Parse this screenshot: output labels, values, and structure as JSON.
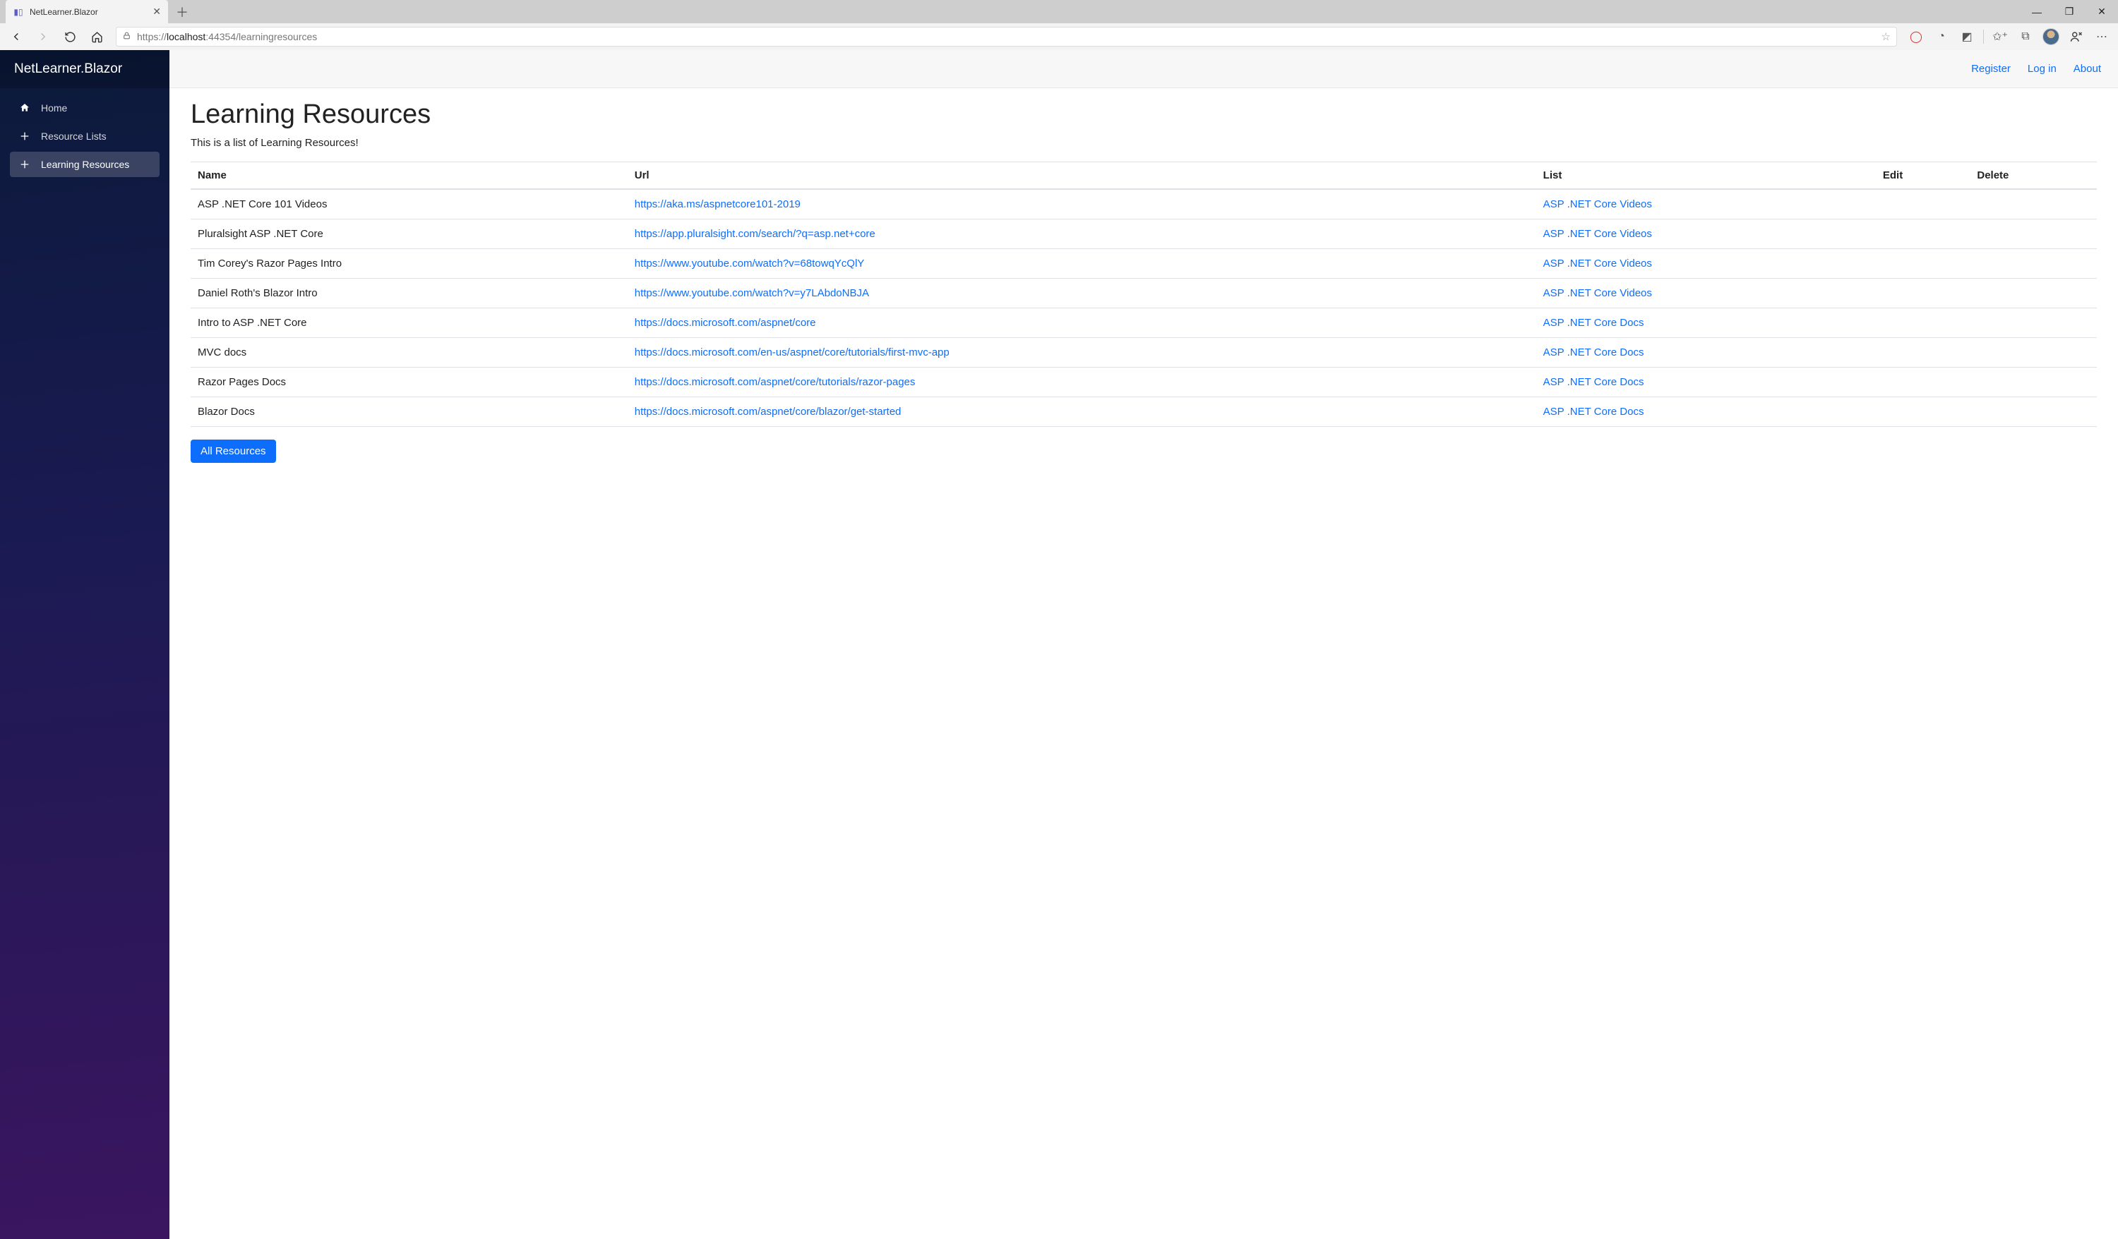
{
  "browser": {
    "tab_title": "NetLearner.Blazor",
    "url_scheme": "https://",
    "url_host": "localhost",
    "url_port_path": ":44354/learningresources"
  },
  "sidebar": {
    "brand": "NetLearner.Blazor",
    "items": [
      {
        "icon": "home",
        "label": "Home",
        "active": false
      },
      {
        "icon": "plus",
        "label": "Resource Lists",
        "active": false
      },
      {
        "icon": "plus",
        "label": "Learning Resources",
        "active": true
      }
    ]
  },
  "topbar": {
    "register": "Register",
    "login": "Log in",
    "about": "About"
  },
  "page": {
    "title": "Learning Resources",
    "subtitle": "This is a list of Learning Resources!",
    "columns": {
      "name": "Name",
      "url": "Url",
      "list": "List",
      "edit": "Edit",
      "delete": "Delete"
    },
    "rows": [
      {
        "name": "ASP .NET Core 101 Videos",
        "url": "https://aka.ms/aspnetcore101-2019",
        "list": "ASP .NET Core Videos"
      },
      {
        "name": "Pluralsight ASP .NET Core",
        "url": "https://app.pluralsight.com/search/?q=asp.net+core",
        "list": "ASP .NET Core Videos"
      },
      {
        "name": "Tim Corey's Razor Pages Intro",
        "url": "https://www.youtube.com/watch?v=68towqYcQlY",
        "list": "ASP .NET Core Videos"
      },
      {
        "name": "Daniel Roth's Blazor Intro",
        "url": "https://www.youtube.com/watch?v=y7LAbdoNBJA",
        "list": "ASP .NET Core Videos"
      },
      {
        "name": "Intro to ASP .NET Core",
        "url": "https://docs.microsoft.com/aspnet/core",
        "list": "ASP .NET Core Docs"
      },
      {
        "name": "MVC docs",
        "url": "https://docs.microsoft.com/en-us/aspnet/core/tutorials/first-mvc-app",
        "list": "ASP .NET Core Docs"
      },
      {
        "name": "Razor Pages Docs",
        "url": "https://docs.microsoft.com/aspnet/core/tutorials/razor-pages",
        "list": "ASP .NET Core Docs"
      },
      {
        "name": "Blazor Docs",
        "url": "https://docs.microsoft.com/aspnet/core/blazor/get-started",
        "list": "ASP .NET Core Docs"
      }
    ],
    "button": "All Resources"
  }
}
